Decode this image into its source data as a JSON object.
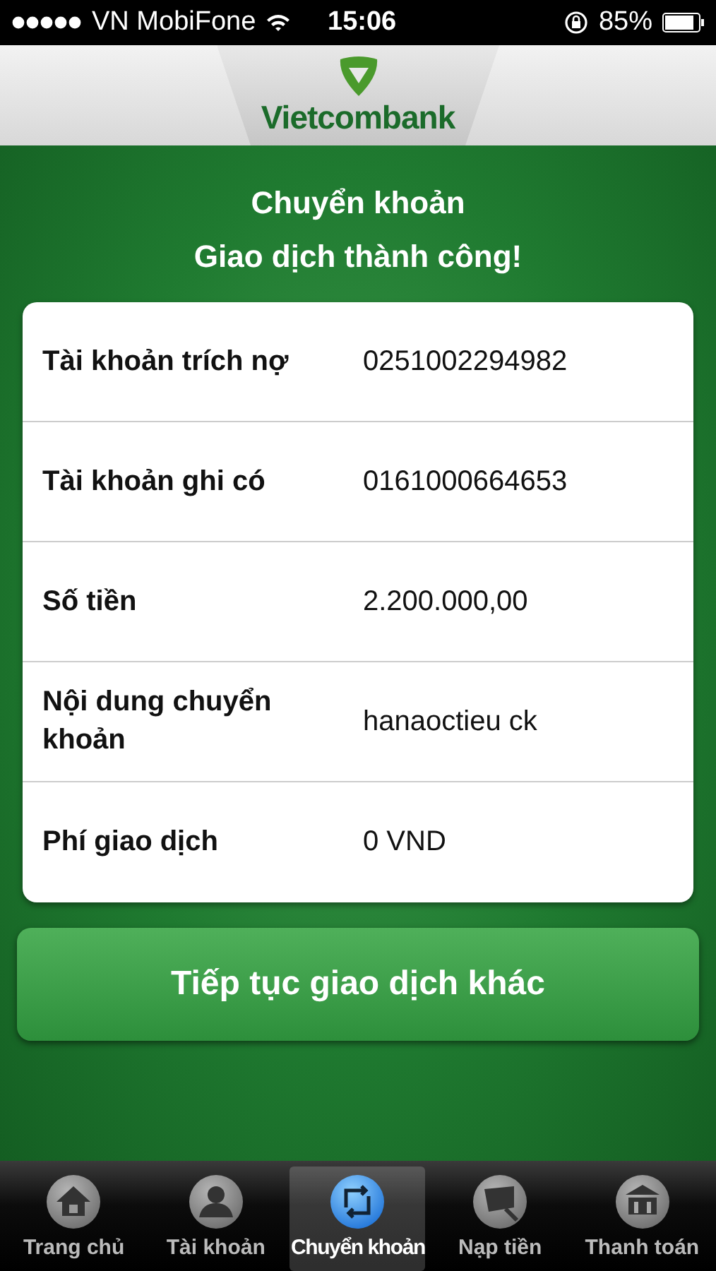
{
  "status_bar": {
    "carrier": "VN MobiFone",
    "time": "15:06",
    "battery": "85%"
  },
  "header": {
    "logo": "Vietcombank"
  },
  "title": "Chuyển khoản",
  "subtitle": "Giao dịch thành công!",
  "details": [
    {
      "label": "Tài khoản trích nợ",
      "value": "0251002294982"
    },
    {
      "label": "Tài khoản ghi có",
      "value": "0161000664653"
    },
    {
      "label": "Số tiền",
      "value": "2.200.000,00"
    },
    {
      "label": "Nội dung chuyển khoản",
      "value": "hanaoctieu ck"
    },
    {
      "label": "Phí giao dịch",
      "value": "0 VND"
    }
  ],
  "continue_button": "Tiếp tục giao dịch khác",
  "tabs": [
    {
      "label": "Trang chủ",
      "selected": false
    },
    {
      "label": "Tài khoản",
      "selected": false
    },
    {
      "label": "Chuyển khoản",
      "selected": true
    },
    {
      "label": "Nạp tiền",
      "selected": false
    },
    {
      "label": "Thanh toán",
      "selected": false
    }
  ]
}
